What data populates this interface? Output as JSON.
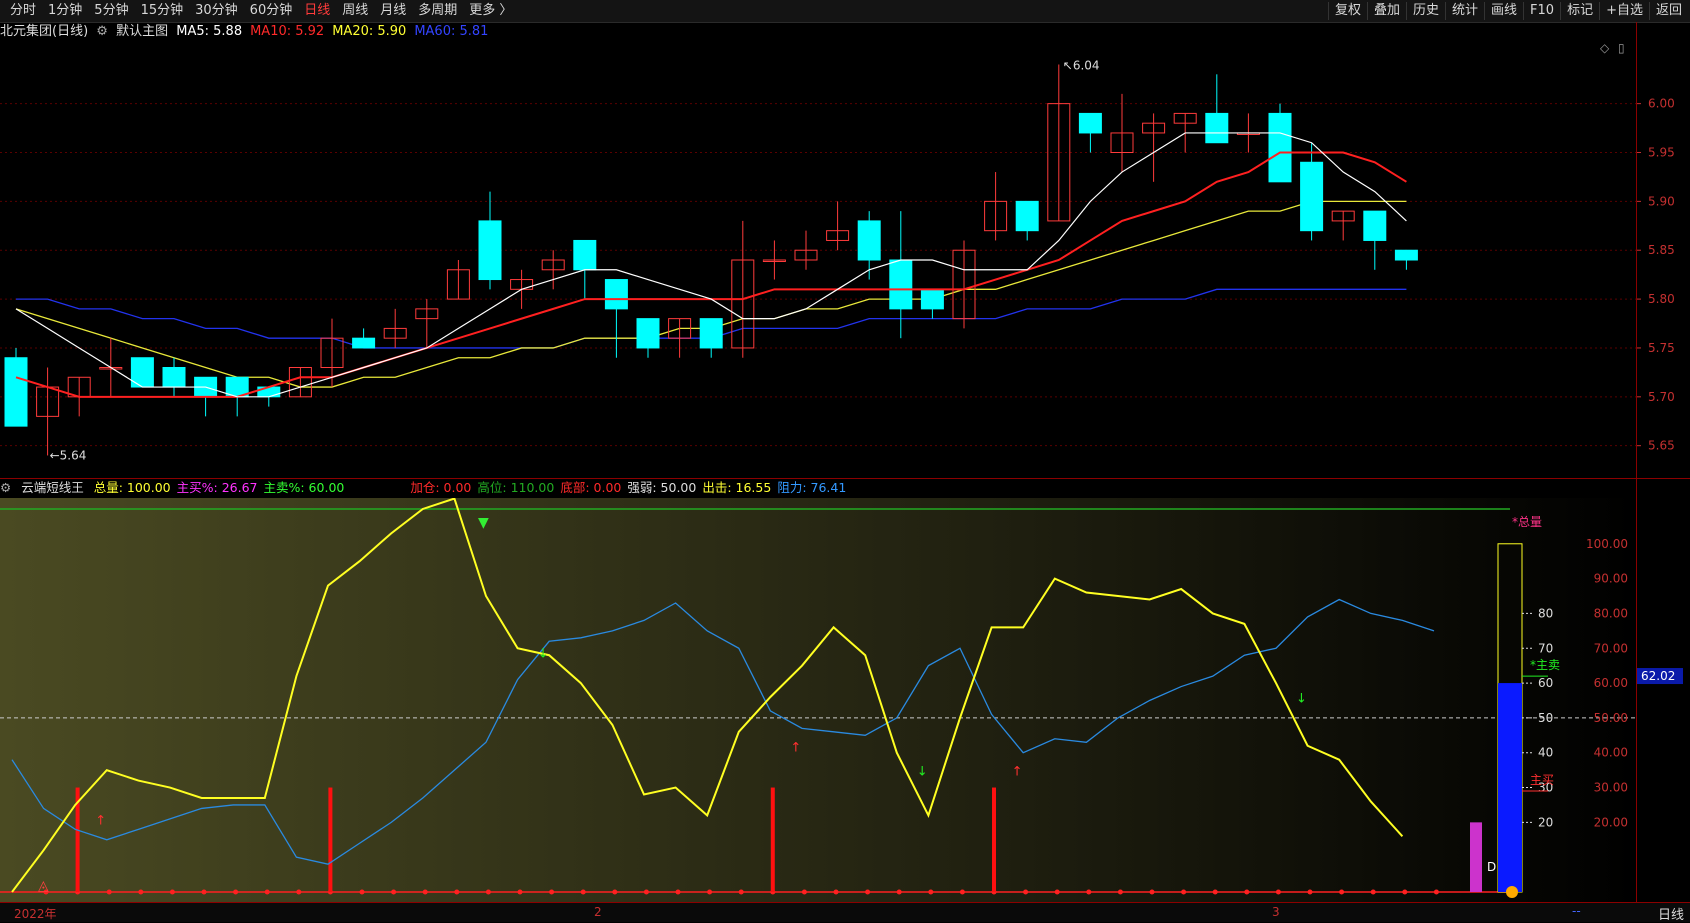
{
  "periods": [
    "分时",
    "1分钟",
    "5分钟",
    "15分钟",
    "30分钟",
    "60分钟",
    "日线",
    "周线",
    "月线",
    "多周期",
    "更多 〉"
  ],
  "active_period": "日线",
  "tools": [
    "复权",
    "叠加",
    "历史",
    "统计",
    "画线",
    "F10",
    "标记",
    "+自选",
    "返回"
  ],
  "main": {
    "stock": "北元集团(日线)",
    "template": "默认主图",
    "ma": [
      {
        "label": "MA5: 5.88",
        "color": "#ffffff"
      },
      {
        "label": "MA10: 5.92",
        "color": "#ff2a2a"
      },
      {
        "label": "MA20: 5.90",
        "color": "#ffff33"
      },
      {
        "label": "MA60: 5.81",
        "color": "#3344ff"
      }
    ],
    "high_label": "6.04",
    "low_label": "5.64",
    "price_ticks": [
      "6.00",
      "5.95",
      "5.90",
      "5.85",
      "5.80",
      "5.75",
      "5.70",
      "5.65"
    ]
  },
  "indicator": {
    "name": "云端短线王",
    "fields": [
      {
        "label": "总量:",
        "value": "100.00",
        "color": "#ffff33"
      },
      {
        "label": "主买%:",
        "value": "26.67",
        "color": "#ff33ff"
      },
      {
        "label": "主卖%:",
        "value": "60.00",
        "color": "#33ff33"
      },
      {
        "label": "加仓:",
        "value": "0.00",
        "color": "#ff2a2a"
      },
      {
        "label": "高位:",
        "value": "110.00",
        "color": "#22aa22"
      },
      {
        "label": "底部:",
        "value": "0.00",
        "color": "#ff2a2a"
      },
      {
        "label": "强弱:",
        "value": "50.00",
        "color": "#dddddd"
      },
      {
        "label": "出击:",
        "value": "16.55",
        "color": "#ffff33"
      },
      {
        "label": "阻力:",
        "value": "76.41",
        "color": "#3399ff"
      }
    ],
    "right_ticks": [
      "100.00",
      "90.00",
      "80.00",
      "70.00",
      "60.00",
      "50.00",
      "40.00",
      "30.00",
      "20.00"
    ],
    "gauge_ticks": [
      "80",
      "70",
      "60",
      "50",
      "40",
      "30",
      "20"
    ],
    "gauge_labels": {
      "total": "*总量",
      "sell": "*主卖",
      "buy": "主买",
      "d": "D"
    },
    "current_value": "62.02"
  },
  "dates": [
    "2022年",
    "2",
    "3"
  ],
  "bottom_period": "日线",
  "bottom_dash": "--",
  "colors": {
    "up": "#ff3b3b",
    "down": "#00ffff",
    "ma5": "#ffffff",
    "ma10": "#ff2020",
    "ma20": "#e8e83a",
    "ma60": "#2233ee"
  },
  "chart_data": {
    "type": "candlestick",
    "candles": [
      {
        "o": 5.74,
        "h": 5.75,
        "l": 5.67,
        "c": 5.67
      },
      {
        "o": 5.68,
        "h": 5.73,
        "l": 5.64,
        "c": 5.71
      },
      {
        "o": 5.7,
        "h": 5.72,
        "l": 5.68,
        "c": 5.72
      },
      {
        "o": 5.73,
        "h": 5.76,
        "l": 5.7,
        "c": 5.73
      },
      {
        "o": 5.74,
        "h": 5.74,
        "l": 5.71,
        "c": 5.71
      },
      {
        "o": 5.73,
        "h": 5.74,
        "l": 5.7,
        "c": 5.71
      },
      {
        "o": 5.72,
        "h": 5.72,
        "l": 5.68,
        "c": 5.7
      },
      {
        "o": 5.72,
        "h": 5.72,
        "l": 5.68,
        "c": 5.7
      },
      {
        "o": 5.71,
        "h": 5.71,
        "l": 5.69,
        "c": 5.7
      },
      {
        "o": 5.7,
        "h": 5.73,
        "l": 5.7,
        "c": 5.73
      },
      {
        "o": 5.73,
        "h": 5.78,
        "l": 5.71,
        "c": 5.76
      },
      {
        "o": 5.76,
        "h": 5.77,
        "l": 5.75,
        "c": 5.75
      },
      {
        "o": 5.76,
        "h": 5.79,
        "l": 5.75,
        "c": 5.77
      },
      {
        "o": 5.78,
        "h": 5.8,
        "l": 5.75,
        "c": 5.79
      },
      {
        "o": 5.8,
        "h": 5.84,
        "l": 5.8,
        "c": 5.83
      },
      {
        "o": 5.88,
        "h": 5.91,
        "l": 5.81,
        "c": 5.82
      },
      {
        "o": 5.81,
        "h": 5.83,
        "l": 5.79,
        "c": 5.82
      },
      {
        "o": 5.83,
        "h": 5.85,
        "l": 5.81,
        "c": 5.84
      },
      {
        "o": 5.86,
        "h": 5.86,
        "l": 5.8,
        "c": 5.83
      },
      {
        "o": 5.82,
        "h": 5.82,
        "l": 5.74,
        "c": 5.79
      },
      {
        "o": 5.78,
        "h": 5.78,
        "l": 5.74,
        "c": 5.75
      },
      {
        "o": 5.76,
        "h": 5.78,
        "l": 5.74,
        "c": 5.78
      },
      {
        "o": 5.78,
        "h": 5.78,
        "l": 5.74,
        "c": 5.75
      },
      {
        "o": 5.75,
        "h": 5.88,
        "l": 5.74,
        "c": 5.84
      },
      {
        "o": 5.84,
        "h": 5.86,
        "l": 5.82,
        "c": 5.84
      },
      {
        "o": 5.84,
        "h": 5.87,
        "l": 5.83,
        "c": 5.85
      },
      {
        "o": 5.86,
        "h": 5.9,
        "l": 5.85,
        "c": 5.87
      },
      {
        "o": 5.88,
        "h": 5.89,
        "l": 5.82,
        "c": 5.84
      },
      {
        "o": 5.84,
        "h": 5.89,
        "l": 5.76,
        "c": 5.79
      },
      {
        "o": 5.81,
        "h": 5.81,
        "l": 5.78,
        "c": 5.79
      },
      {
        "o": 5.78,
        "h": 5.86,
        "l": 5.77,
        "c": 5.85
      },
      {
        "o": 5.87,
        "h": 5.93,
        "l": 5.86,
        "c": 5.9
      },
      {
        "o": 5.9,
        "h": 5.9,
        "l": 5.86,
        "c": 5.87
      },
      {
        "o": 5.88,
        "h": 6.04,
        "l": 5.88,
        "c": 6.0
      },
      {
        "o": 5.99,
        "h": 5.99,
        "l": 5.95,
        "c": 5.97
      },
      {
        "o": 5.95,
        "h": 6.01,
        "l": 5.93,
        "c": 5.97
      },
      {
        "o": 5.97,
        "h": 5.99,
        "l": 5.92,
        "c": 5.98
      },
      {
        "o": 5.98,
        "h": 5.99,
        "l": 5.95,
        "c": 5.99
      },
      {
        "o": 5.99,
        "h": 6.03,
        "l": 5.96,
        "c": 5.96
      },
      {
        "o": 5.97,
        "h": 5.99,
        "l": 5.95,
        "c": 5.97
      },
      {
        "o": 5.99,
        "h": 6.0,
        "l": 5.92,
        "c": 5.92
      },
      {
        "o": 5.94,
        "h": 5.96,
        "l": 5.86,
        "c": 5.87
      },
      {
        "o": 5.88,
        "h": 5.89,
        "l": 5.86,
        "c": 5.89
      },
      {
        "o": 5.89,
        "h": 5.89,
        "l": 5.83,
        "c": 5.86
      },
      {
        "o": 5.85,
        "h": 5.85,
        "l": 5.83,
        "c": 5.84
      }
    ],
    "ma5": [
      5.79,
      5.77,
      5.75,
      5.73,
      5.71,
      5.71,
      5.71,
      5.7,
      5.7,
      5.71,
      5.72,
      5.73,
      5.74,
      5.75,
      5.77,
      5.79,
      5.81,
      5.82,
      5.83,
      5.83,
      5.82,
      5.81,
      5.8,
      5.78,
      5.78,
      5.79,
      5.81,
      5.83,
      5.84,
      5.84,
      5.83,
      5.83,
      5.83,
      5.86,
      5.9,
      5.93,
      5.95,
      5.97,
      5.97,
      5.97,
      5.97,
      5.96,
      5.93,
      5.91,
      5.88
    ],
    "ma10": [
      5.72,
      5.71,
      5.7,
      5.7,
      5.7,
      5.7,
      5.7,
      5.7,
      5.71,
      5.72,
      5.72,
      5.73,
      5.74,
      5.75,
      5.76,
      5.77,
      5.78,
      5.79,
      5.8,
      5.8,
      5.8,
      5.8,
      5.8,
      5.8,
      5.81,
      5.81,
      5.81,
      5.81,
      5.81,
      5.81,
      5.81,
      5.82,
      5.83,
      5.84,
      5.86,
      5.88,
      5.89,
      5.9,
      5.92,
      5.93,
      5.95,
      5.95,
      5.95,
      5.94,
      5.92
    ],
    "ma20": [
      5.79,
      5.78,
      5.77,
      5.76,
      5.75,
      5.74,
      5.73,
      5.72,
      5.72,
      5.71,
      5.71,
      5.72,
      5.72,
      5.73,
      5.74,
      5.74,
      5.75,
      5.75,
      5.76,
      5.76,
      5.76,
      5.77,
      5.77,
      5.78,
      5.78,
      5.79,
      5.79,
      5.8,
      5.8,
      5.8,
      5.81,
      5.81,
      5.82,
      5.83,
      5.84,
      5.85,
      5.86,
      5.87,
      5.88,
      5.89,
      5.89,
      5.9,
      5.9,
      5.9,
      5.9
    ],
    "ma60": [
      5.8,
      5.8,
      5.79,
      5.79,
      5.78,
      5.78,
      5.77,
      5.77,
      5.76,
      5.76,
      5.76,
      5.75,
      5.75,
      5.75,
      5.75,
      5.75,
      5.75,
      5.75,
      5.76,
      5.76,
      5.76,
      5.76,
      5.76,
      5.77,
      5.77,
      5.77,
      5.77,
      5.78,
      5.78,
      5.78,
      5.78,
      5.78,
      5.79,
      5.79,
      5.79,
      5.8,
      5.8,
      5.8,
      5.81,
      5.81,
      5.81,
      5.81,
      5.81,
      5.81,
      5.81
    ],
    "ylim": [
      5.62,
      6.06
    ],
    "indicator_yellow": [
      0,
      12,
      25,
      35,
      32,
      30,
      27,
      27,
      27,
      62,
      88,
      95,
      103,
      110,
      113,
      85,
      70,
      68,
      60,
      48,
      28,
      30,
      22,
      46,
      56,
      65,
      76,
      68,
      40,
      22,
      50,
      76,
      76,
      90,
      86,
      85,
      84,
      87,
      80,
      77,
      60,
      42,
      38,
      26,
      16
    ],
    "indicator_blue": [
      38,
      24,
      18,
      15,
      18,
      21,
      24,
      25,
      25,
      10,
      8,
      14,
      20,
      27,
      35,
      43,
      61,
      72,
      73,
      75,
      78,
      83,
      75,
      70,
      52,
      47,
      46,
      45,
      50,
      65,
      70,
      51,
      40,
      44,
      43,
      50,
      55,
      59,
      62,
      68,
      70,
      79,
      84,
      80,
      78,
      75
    ],
    "indicator_ylim": [
      0,
      112
    ]
  }
}
